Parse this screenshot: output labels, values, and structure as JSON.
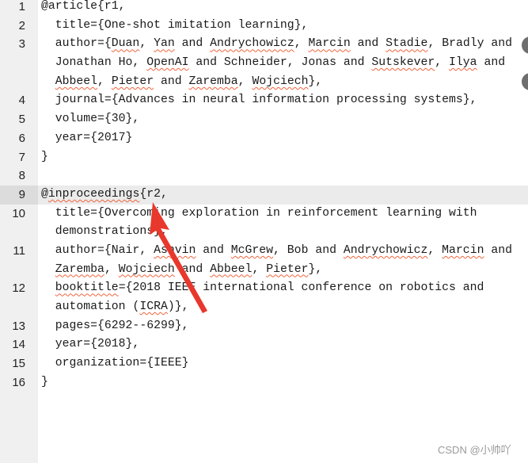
{
  "editor": {
    "lines": [
      {
        "n": "1",
        "rows": [
          [
            [
              "@article{r1,",
              0
            ]
          ]
        ]
      },
      {
        "n": "2",
        "rows": [
          [
            [
              "  title={One-shot imitation learning},",
              0
            ]
          ]
        ]
      },
      {
        "n": "3",
        "rows": [
          [
            [
              "  author={",
              0
            ],
            [
              "Duan",
              1
            ],
            [
              ", ",
              0
            ],
            [
              "Yan",
              1
            ],
            [
              " and ",
              0
            ],
            [
              "Andrychowicz",
              1
            ],
            [
              ", ",
              0
            ],
            [
              "Marcin",
              1
            ],
            [
              " and ",
              0
            ],
            [
              "Stadie",
              1
            ],
            [
              ", Bradly and",
              0
            ]
          ],
          [
            [
              "  Jonathan Ho, ",
              0
            ],
            [
              "OpenAI",
              1
            ],
            [
              " and Schneider, Jonas and ",
              0
            ],
            [
              "Sutskever",
              1
            ],
            [
              ", ",
              0
            ],
            [
              "Ilya",
              1
            ],
            [
              " and",
              0
            ]
          ],
          [
            [
              "  ",
              0
            ],
            [
              "Abbeel",
              1
            ],
            [
              ", ",
              0
            ],
            [
              "Pieter",
              1
            ],
            [
              " and ",
              0
            ],
            [
              "Zaremba",
              1
            ],
            [
              ", ",
              0
            ],
            [
              "Wojciech",
              1
            ],
            [
              "},",
              0
            ]
          ]
        ]
      },
      {
        "n": "4",
        "rows": [
          [
            [
              "  journal={Advances in neural information processing systems},",
              0
            ]
          ]
        ]
      },
      {
        "n": "5",
        "rows": [
          [
            [
              "  volume={30},",
              0
            ]
          ]
        ]
      },
      {
        "n": "6",
        "rows": [
          [
            [
              "  year={2017}",
              0
            ]
          ]
        ]
      },
      {
        "n": "7",
        "rows": [
          [
            [
              "}",
              0
            ]
          ]
        ]
      },
      {
        "n": "8",
        "rows": [
          [
            [
              "",
              0
            ]
          ]
        ]
      },
      {
        "n": "9",
        "highlight": true,
        "rows": [
          [
            [
              "@",
              0
            ],
            [
              "inproceedings",
              1
            ],
            [
              "{r2,",
              0
            ]
          ]
        ]
      },
      {
        "n": "10",
        "rows": [
          [
            [
              "  title={Overcoming exploration in reinforcement learning with",
              0
            ]
          ],
          [
            [
              "  demonstrations},",
              0
            ]
          ]
        ]
      },
      {
        "n": "11",
        "rows": [
          [
            [
              "  author={Nair, ",
              0
            ],
            [
              "Ashvin",
              1
            ],
            [
              " and ",
              0
            ],
            [
              "McGrew",
              1
            ],
            [
              ", Bob and ",
              0
            ],
            [
              "Andrychowicz",
              1
            ],
            [
              ", ",
              0
            ],
            [
              "Marcin",
              1
            ],
            [
              " and",
              0
            ]
          ],
          [
            [
              "  ",
              0
            ],
            [
              "Zaremba",
              1
            ],
            [
              ", ",
              0
            ],
            [
              "Wojciech",
              1
            ],
            [
              " and ",
              0
            ],
            [
              "Abbeel",
              1
            ],
            [
              ", ",
              0
            ],
            [
              "Pieter",
              1
            ],
            [
              "},",
              0
            ]
          ]
        ]
      },
      {
        "n": "12",
        "rows": [
          [
            [
              "  ",
              0
            ],
            [
              "booktitle",
              1
            ],
            [
              "={2018 IEEE international conference on robotics and",
              0
            ]
          ],
          [
            [
              "  automation (",
              0
            ],
            [
              "ICRA",
              1
            ],
            [
              ")},",
              0
            ]
          ]
        ]
      },
      {
        "n": "13",
        "rows": [
          [
            [
              "  pages={6292--6299},",
              0
            ]
          ]
        ]
      },
      {
        "n": "14",
        "rows": [
          [
            [
              "  year={2018},",
              0
            ]
          ]
        ]
      },
      {
        "n": "15",
        "rows": [
          [
            [
              "  organization={IEEE}",
              0
            ]
          ]
        ]
      },
      {
        "n": "16",
        "rows": [
          [
            [
              "}",
              0
            ]
          ]
        ]
      }
    ]
  },
  "watermark": "CSDN @小帅吖",
  "colors": {
    "arrow": "#e8372c",
    "spell_error": "#f0643c"
  }
}
